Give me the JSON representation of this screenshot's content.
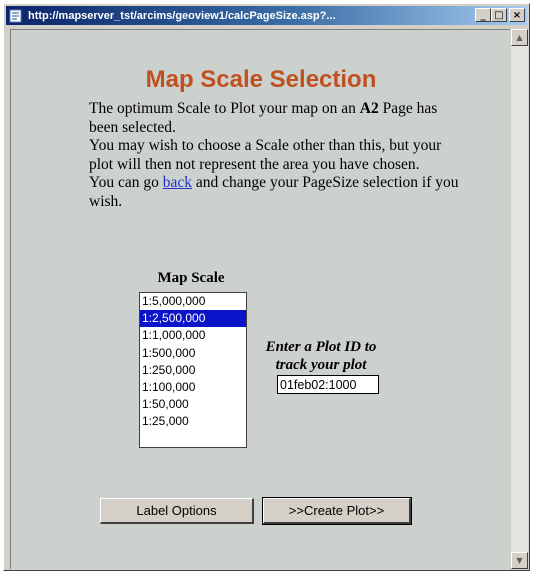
{
  "window": {
    "title": "http://mapserver_tst/arcims/geoview1/calcPageSize.asp?...",
    "icons": {
      "app": "ie-page-icon",
      "minimize": "minimize-icon",
      "maximize": "maximize-icon",
      "close": "close-icon"
    },
    "buttons": {
      "minimize": "_",
      "maximize": "□",
      "close": "×"
    }
  },
  "page": {
    "heading": "Map Scale Selection",
    "para1_before": "The optimum Scale to Plot your map on an ",
    "para1_bold": "A2",
    "para1_after": " Page has been selected.",
    "para2": "You may wish to choose a Scale other than this, but your plot will then not represent the area you have chosen.",
    "para3_before": "You can go ",
    "para3_link": "back",
    "para3_after": " and change your PageSize selection if you wish."
  },
  "map_scale": {
    "label": "Map Scale",
    "options": [
      "1:5,000,000",
      "1:2,500,000",
      "1:1,000,000",
      "1:500,000",
      "1:250,000",
      "1:100,000",
      "1:50,000",
      "1:25,000"
    ],
    "selected": "1:2,500,000"
  },
  "plot_id": {
    "label_line1": "Enter a Plot ID to",
    "label_line2": "track your plot",
    "value": "01feb02:1000"
  },
  "buttons": {
    "label_options": "Label Options",
    "create_plot": ">>Create Plot>>"
  },
  "scrollbar": {
    "up": "▲",
    "down": "▼"
  },
  "colors": {
    "heading": "#c0501e",
    "selection": "#0a14c8",
    "link": "#2233cc",
    "page_bg": "#cdd1cd"
  }
}
